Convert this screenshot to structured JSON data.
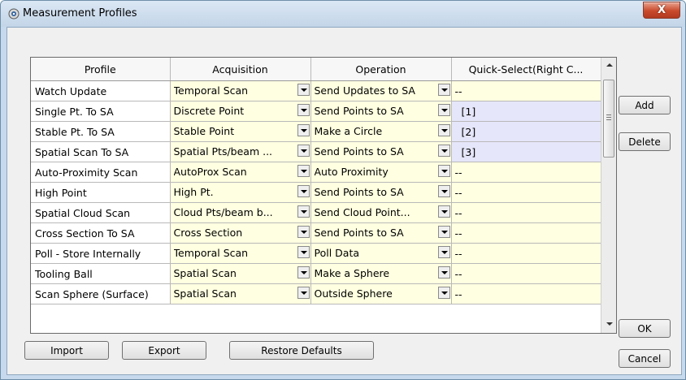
{
  "window": {
    "title": "Measurement Profiles",
    "close_label": "X"
  },
  "table": {
    "columns": [
      "Profile",
      "Acquisition",
      "Operation",
      "Quick-Select(Right C..."
    ],
    "rows": [
      {
        "profile": "Watch Update",
        "acquisition": "Temporal Scan",
        "operation": "Send Updates to SA",
        "quick_select": "--",
        "highlight": false
      },
      {
        "profile": "Single Pt. To SA",
        "acquisition": "Discrete Point",
        "operation": "Send Points to SA",
        "quick_select": "[1]",
        "highlight": true
      },
      {
        "profile": "Stable Pt. To SA",
        "acquisition": "Stable Point",
        "operation": "Make a Circle",
        "quick_select": "[2]",
        "highlight": true
      },
      {
        "profile": "Spatial Scan To SA",
        "acquisition": "Spatial Pts/beam ...",
        "operation": "Send Points to SA",
        "quick_select": "[3]",
        "highlight": true
      },
      {
        "profile": "Auto-Proximity Scan",
        "acquisition": "AutoProx Scan",
        "operation": "Auto Proximity",
        "quick_select": "--",
        "highlight": false
      },
      {
        "profile": "High Point",
        "acquisition": "High Pt.",
        "operation": "Send Points to SA",
        "quick_select": "--",
        "highlight": false
      },
      {
        "profile": "Spatial Cloud Scan",
        "acquisition": "Cloud Pts/beam b...",
        "operation": "Send Cloud Point...",
        "quick_select": "--",
        "highlight": false
      },
      {
        "profile": "Cross Section To SA",
        "acquisition": "Cross Section",
        "operation": "Send Points to SA",
        "quick_select": "--",
        "highlight": false
      },
      {
        "profile": "Poll - Store Internally",
        "acquisition": "Temporal Scan",
        "operation": "Poll Data",
        "quick_select": "--",
        "highlight": false
      },
      {
        "profile": "Tooling Ball",
        "acquisition": "Spatial Scan",
        "operation": "Make a Sphere",
        "quick_select": "--",
        "highlight": false
      },
      {
        "profile": "Scan Sphere (Surface)",
        "acquisition": "Spatial Scan",
        "operation": "Outside Sphere",
        "quick_select": "--",
        "highlight": false
      }
    ]
  },
  "buttons": {
    "add": "Add",
    "delete": "Delete",
    "ok": "OK",
    "cancel": "Cancel",
    "import": "Import",
    "export": "Export",
    "restore_defaults": "Restore Defaults"
  }
}
